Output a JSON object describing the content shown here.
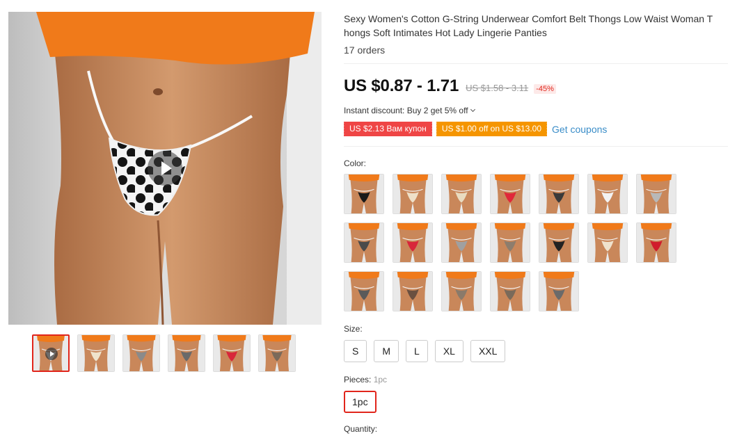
{
  "product": {
    "title": "Sexy Women's Cotton G-String Underwear Comfort Belt Thongs Low Waist Woman Thongs Soft Intimates Hot Lady Lingerie Panties",
    "title_line1": "Sexy Women's Cotton G-String Underwear Comfort Belt Thongs Low Waist Woman T",
    "title_line2": "hongs Soft Intimates Hot Lady Lingerie Panties",
    "orders": "17 orders"
  },
  "price": {
    "current": "US $0.87 - 1.71",
    "original": "US $1.58 - 3.11",
    "discount": "-45%"
  },
  "promo": {
    "instant_discount": "Instant discount: Buy 2 get 5% off",
    "coupon1": "US $2.13 Вам купон",
    "coupon2": "US $1.00 off on US $13.00",
    "get_coupons": "Get coupons"
  },
  "color": {
    "label": "Color:",
    "swatches": [
      {
        "fabric": "#1a1a1a"
      },
      {
        "fabric": "#efe0c8"
      },
      {
        "fabric": "#e9dbc0"
      },
      {
        "fabric": "#e0283a"
      },
      {
        "fabric": "#3a3a3a"
      },
      {
        "fabric": "#f2f2f2"
      },
      {
        "fabric": "#b8b8b8"
      },
      {
        "fabric": "#4a4a4a"
      },
      {
        "fabric": "#d8263a"
      },
      {
        "fabric": "#a0a0a0"
      },
      {
        "fabric": "#8d7d6d"
      },
      {
        "fabric": "#222222"
      },
      {
        "fabric": "#efe2cd"
      },
      {
        "fabric": "#d01c2c"
      },
      {
        "fabric": "#5a5a5a"
      },
      {
        "fabric": "#6a5040"
      },
      {
        "fabric": "#8a7a6a"
      },
      {
        "fabric": "#7a6a5a"
      },
      {
        "fabric": "#6a6a6a"
      }
    ]
  },
  "size": {
    "label": "Size:",
    "options": [
      "S",
      "M",
      "L",
      "XL",
      "XXL"
    ]
  },
  "pieces": {
    "label": "Pieces:",
    "selected_value": "1pc",
    "options": [
      "1pc"
    ]
  },
  "quantity": {
    "label": "Quantity:"
  },
  "gallery": {
    "thumbnails": [
      {
        "fabric": "#f4f4f4"
      },
      {
        "fabric": "#efe3cc"
      },
      {
        "fabric": "#8a8a8a"
      },
      {
        "fabric": "#6a6a6a"
      },
      {
        "fabric": "#d8263a"
      },
      {
        "fabric": "#7a6a5a"
      }
    ]
  },
  "colors": {
    "accent": "#e1251b",
    "coupon_red": "#ef4545",
    "coupon_orange": "#f59500",
    "link": "#3a8dc8",
    "skin": "#c9875a",
    "shirt": "#f07a1a"
  }
}
